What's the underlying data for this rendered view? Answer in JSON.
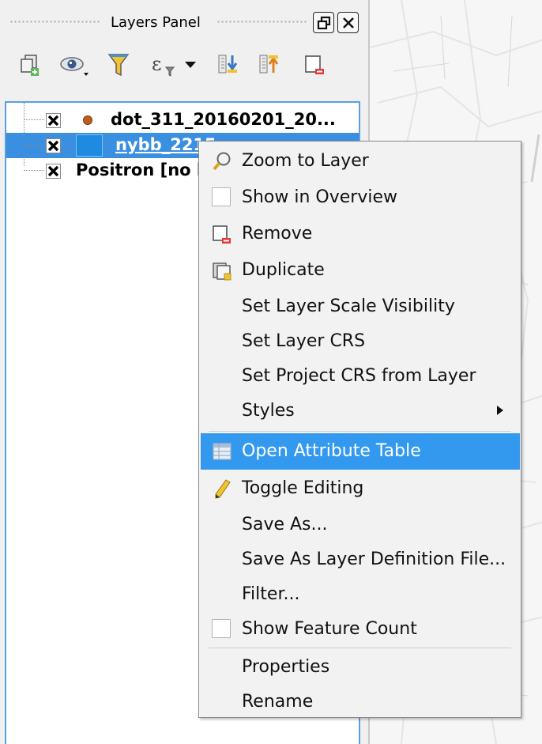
{
  "panel": {
    "title": "Layers Panel",
    "toolbar": [
      {
        "icon": "add-group-icon"
      },
      {
        "icon": "eye-visibility-icon"
      },
      {
        "icon": "filter-funnel-icon"
      },
      {
        "icon": "expression-filter-icon"
      },
      {
        "icon": "expand-all-icon"
      },
      {
        "icon": "collapse-all-icon"
      },
      {
        "icon": "remove-layer-icon"
      }
    ]
  },
  "layers": [
    {
      "name": "dot_311_20160201_20...",
      "checked": true,
      "symbol_color": "#c05c1c"
    },
    {
      "name": "nybb_2215",
      "checked": true,
      "symbol_color": "#1e8ae0",
      "selected": true
    },
    {
      "name": "Positron [no labels]",
      "checked": true
    }
  ],
  "context_menu": {
    "items": [
      {
        "label": "Zoom to Layer",
        "icon": "magnifier-icon"
      },
      {
        "label": "Show in Overview",
        "icon": "checkbox-icon"
      },
      {
        "label": "Remove",
        "icon": "remove-layer-icon"
      },
      {
        "label": "Duplicate",
        "icon": "duplicate-icon"
      },
      {
        "label": "Set Layer Scale Visibility"
      },
      {
        "label": "Set Layer CRS"
      },
      {
        "label": "Set Project CRS from Layer"
      },
      {
        "label": "Styles",
        "submenu": true
      },
      {
        "label": "Open Attribute Table",
        "icon": "attribute-table-icon",
        "highlighted": true
      },
      {
        "label": "Toggle Editing",
        "icon": "pencil-icon"
      },
      {
        "label": "Save As..."
      },
      {
        "label": "Save As Layer Definition File..."
      },
      {
        "label": "Filter..."
      },
      {
        "label": "Show Feature Count",
        "icon": "checkbox-icon"
      },
      {
        "label": "Properties"
      },
      {
        "label": "Rename"
      }
    ]
  },
  "colors": {
    "selection": "#3b8fe0",
    "menu_highlight": "#3399ee"
  }
}
